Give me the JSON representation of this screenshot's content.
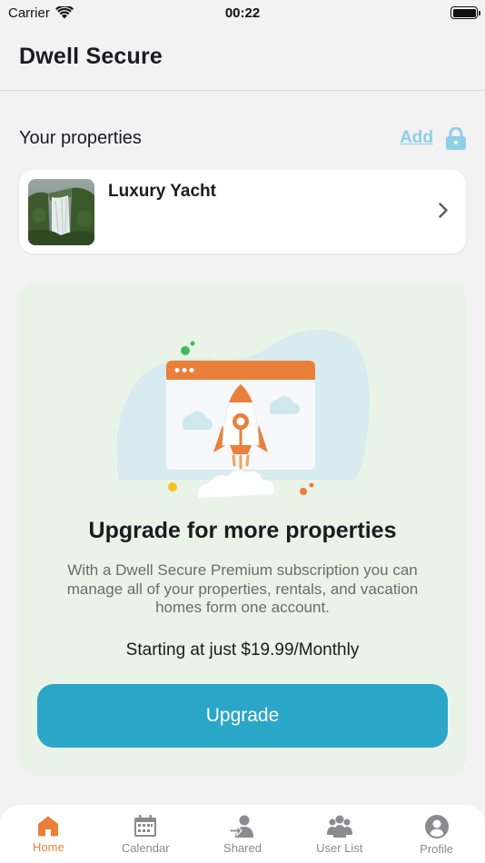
{
  "status_bar": {
    "carrier": "Carrier",
    "time": "00:22"
  },
  "header": {
    "title": "Dwell Secure"
  },
  "properties_section": {
    "title": "Your properties",
    "add_label": "Add",
    "items": [
      {
        "name": "Luxury Yacht",
        "thumbnail": "waterfall-photo"
      }
    ]
  },
  "upgrade": {
    "title": "Upgrade for more properties",
    "description": "With a Dwell Secure Premium subscription you can manage all of your properties, rentals, and vacation homes form one account.",
    "price": "Starting at just $19.99/Monthly",
    "button_label": "Upgrade"
  },
  "tab_bar": {
    "tabs": [
      {
        "label": "Home",
        "icon": "home-icon",
        "active": true
      },
      {
        "label": "Calendar",
        "icon": "calendar-icon",
        "active": false
      },
      {
        "label": "Shared",
        "icon": "shared-icon",
        "active": false
      },
      {
        "label": "User List",
        "icon": "user-list-icon",
        "active": false
      },
      {
        "label": "Profile",
        "icon": "profile-icon",
        "active": false
      }
    ]
  },
  "colors": {
    "accent": "#e97f39",
    "primary_button": "#2aa6c8",
    "add_link": "#8fcfe4",
    "upgrade_card_bg": "#eaf3e8",
    "tab_inactive": "#8a8a8f"
  }
}
